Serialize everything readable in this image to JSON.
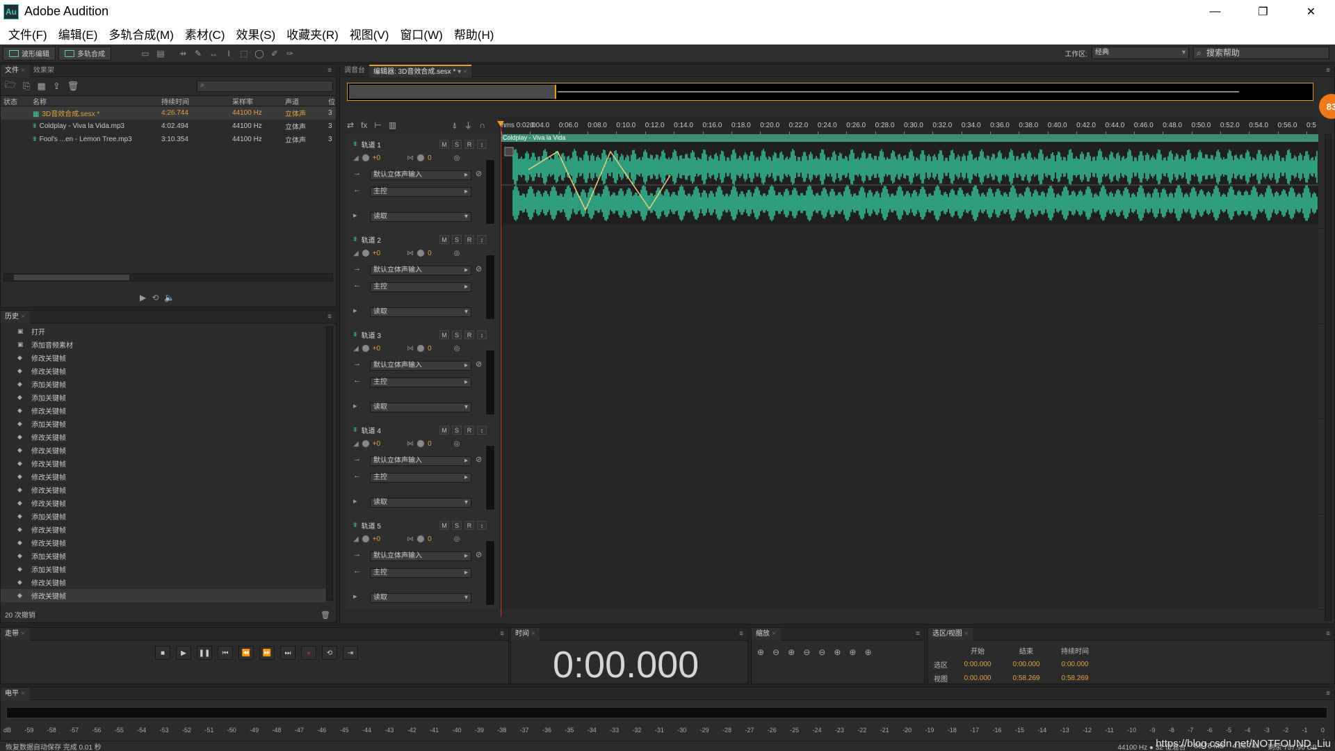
{
  "window": {
    "title": "Adobe Audition",
    "icon_text": "Au",
    "min": "—",
    "restore": "❐",
    "close": "✕"
  },
  "menu": [
    "文件(F)",
    "编辑(E)",
    "多轨合成(M)",
    "素材(C)",
    "效果(S)",
    "收藏夹(R)",
    "视图(V)",
    "窗口(W)",
    "帮助(H)"
  ],
  "toolbar": {
    "waveform_label": "波形编辑",
    "multitrack_label": "多轨合成",
    "workspace_label": "工作区:",
    "workspace_value": "经典",
    "help_search": "搜索帮助"
  },
  "files_panel": {
    "tabs": [
      "文件",
      "效果架"
    ],
    "columns": [
      "状态",
      "名称",
      "持续时间",
      "采样率",
      "声道",
      "位"
    ],
    "rows": [
      {
        "name": "3D音效合成.sesx *",
        "duration": "4:26.744",
        "rate": "44100 Hz",
        "channels": "立体声",
        "bits": "3",
        "highlight": true
      },
      {
        "name": "Coldplay - Viva la Vida.mp3",
        "duration": "4:02.494",
        "rate": "44100 Hz",
        "channels": "立体声",
        "bits": "3",
        "highlight": false
      },
      {
        "name": "Fool's ...en - Lemon Tree.mp3",
        "duration": "3:10.354",
        "rate": "44100 Hz",
        "channels": "立体声",
        "bits": "3",
        "highlight": false
      }
    ]
  },
  "history_panel": {
    "tab": "历史",
    "items": [
      "打开",
      "添加音频素材",
      "修改关键帧",
      "修改关键帧",
      "添加关键帧",
      "添加关键帧",
      "修改关键帧",
      "添加关键帧",
      "修改关键帧",
      "修改关键帧",
      "修改关键帧",
      "修改关键帧",
      "修改关键帧",
      "修改关键帧",
      "添加关键帧",
      "修改关键帧",
      "修改关键帧",
      "添加关键帧",
      "添加关键帧",
      "修改关键帧",
      "修改关键帧"
    ],
    "footer": "20 次撤销"
  },
  "editor": {
    "tabs": [
      "调音台",
      "编辑器: 3D音效合成.sesx *"
    ],
    "ruler": [
      "hms 0:02.0",
      "0:04.0",
      "0:06.0",
      "0:08.0",
      "0:10.0",
      "0:12.0",
      "0:14.0",
      "0:16.0",
      "0:18.0",
      "0:20.0",
      "0:22.0",
      "0:24.0",
      "0:26.0",
      "0:28.0",
      "0:30.0",
      "0:32.0",
      "0:34.0",
      "0:36.0",
      "0:38.0",
      "0:40.0",
      "0:42.0",
      "0:44.0",
      "0:46.0",
      "0:48.0",
      "0:50.0",
      "0:52.0",
      "0:54.0",
      "0:56.0",
      "0:5"
    ],
    "zoom_badge": "83",
    "tracks": [
      {
        "name": "轨道 1",
        "vol": "+0",
        "pan": "0",
        "input": "默认立体声输入",
        "output": "主控",
        "mode": "读取",
        "clip": "Coldplay - Viva la Vida"
      },
      {
        "name": "轨道 2",
        "vol": "+0",
        "pan": "0",
        "input": "默认立体声输入",
        "output": "主控",
        "mode": "读取",
        "clip": ""
      },
      {
        "name": "轨道 3",
        "vol": "+0",
        "pan": "0",
        "input": "默认立体声输入",
        "output": "主控",
        "mode": "读取",
        "clip": ""
      },
      {
        "name": "轨道 4",
        "vol": "+0",
        "pan": "0",
        "input": "默认立体声输入",
        "output": "主控",
        "mode": "读取",
        "clip": ""
      },
      {
        "name": "轨道 5",
        "vol": "+0",
        "pan": "0",
        "input": "默认立体声输入",
        "output": "主控",
        "mode": "读取",
        "clip": ""
      }
    ],
    "msr": [
      "M",
      "S",
      "R"
    ]
  },
  "transport": {
    "tab": "走带"
  },
  "time_panel": {
    "tab": "时间",
    "value": "0:00.000"
  },
  "zoom_panel": {
    "tab": "缩放"
  },
  "selection_panel": {
    "tab": "选区/视图",
    "headers": [
      "开始",
      "结束",
      "持续时间"
    ],
    "selection_label": "选区",
    "selection": [
      "0:00.000",
      "0:00.000",
      "0:00.000"
    ],
    "view_label": "视图",
    "view": [
      "0:00.000",
      "0:58.269",
      "0:58.269"
    ]
  },
  "level_panel": {
    "tab": "电平",
    "scale": [
      "dB",
      "-59",
      "-58",
      "-57",
      "-56",
      "-55",
      "-54",
      "-53",
      "-52",
      "-51",
      "-50",
      "-49",
      "-48",
      "-47",
      "-46",
      "-45",
      "-44",
      "-43",
      "-42",
      "-41",
      "-40",
      "-39",
      "-38",
      "-37",
      "-36",
      "-35",
      "-34",
      "-33",
      "-32",
      "-31",
      "-30",
      "-29",
      "-28",
      "-27",
      "-26",
      "-25",
      "-24",
      "-23",
      "-22",
      "-21",
      "-20",
      "-19",
      "-18",
      "-17",
      "-16",
      "-15",
      "-14",
      "-13",
      "-12",
      "-11",
      "-10",
      "-9",
      "-8",
      "-7",
      "-6",
      "-5",
      "-4",
      "-3",
      "-2",
      "-1",
      "0"
    ]
  },
  "status": {
    "left": "恢复数据自动保存 完成 0.01 秒",
    "format": "44100 Hz ● 32 位混合",
    "size": "89.75 MB",
    "duration": "4:26.744",
    "free": "剩余 757.90 GB",
    "watermark": "https://blog.csdn.net/NOTFOUND_Liu"
  },
  "colors": {
    "accent": "#e8a020",
    "wave": "#35d3a6",
    "playhead": "#c23030"
  }
}
